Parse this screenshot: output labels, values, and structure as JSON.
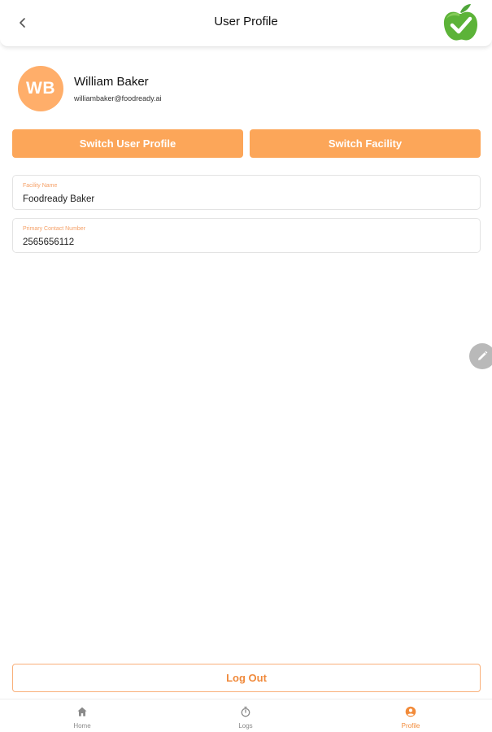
{
  "header": {
    "title": "User Profile",
    "back_icon": "chevron-left-icon",
    "logo_icon": "apple-check-logo"
  },
  "profile": {
    "initials": "WB",
    "name": "William Baker",
    "email": "williambaker@foodready.ai",
    "avatar_color": "#ffae6a"
  },
  "actions": {
    "switch_user_label": "Switch User Profile",
    "switch_facility_label": "Switch Facility",
    "accent_color": "#fca659"
  },
  "fields": {
    "facility": {
      "label": "Facility Name",
      "value": "Foodready Baker"
    },
    "phone": {
      "label": "Primary Contact Number",
      "value": "2565656112"
    }
  },
  "edit_fab": {
    "icon": "pencil-icon"
  },
  "logout": {
    "label": "Log Out"
  },
  "bottom_nav": {
    "items": [
      {
        "label": "Home",
        "icon": "home-icon",
        "active": false
      },
      {
        "label": "Logs",
        "icon": "timer-icon",
        "active": false
      },
      {
        "label": "Profile",
        "icon": "user-circle-icon",
        "active": true
      }
    ]
  }
}
